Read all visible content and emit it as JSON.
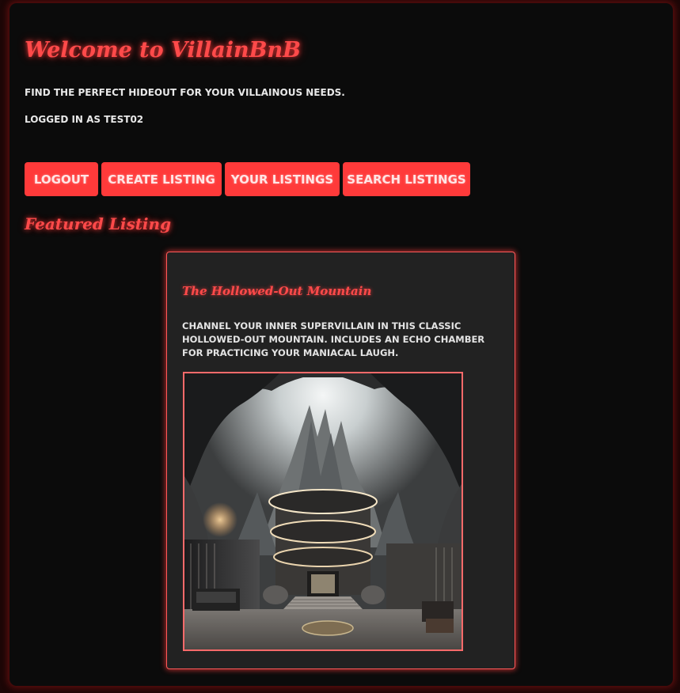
{
  "header": {
    "title": "Welcome to VillainBnB",
    "tagline": "Find the perfect hideout for your villainous needs.",
    "login_status": "Logged in as test02"
  },
  "nav": {
    "logout_label": "Logout",
    "create_label": "Create Listing",
    "your_listings_label": "Your Listings",
    "search_label": "Search Listings"
  },
  "featured": {
    "heading": "Featured Listing",
    "listing": {
      "title": "The Hollowed-Out Mountain",
      "description": "Channel your inner supervillain in this classic hollowed-out mountain. Includes an echo chamber for practicing your maniacal laugh.",
      "image_icon": "hollowed-mountain-lair-photo"
    }
  },
  "colors": {
    "accent": "#ff3a3a",
    "background": "#0b0b0b",
    "card_background": "#222222",
    "text": "#e8e8e8"
  }
}
